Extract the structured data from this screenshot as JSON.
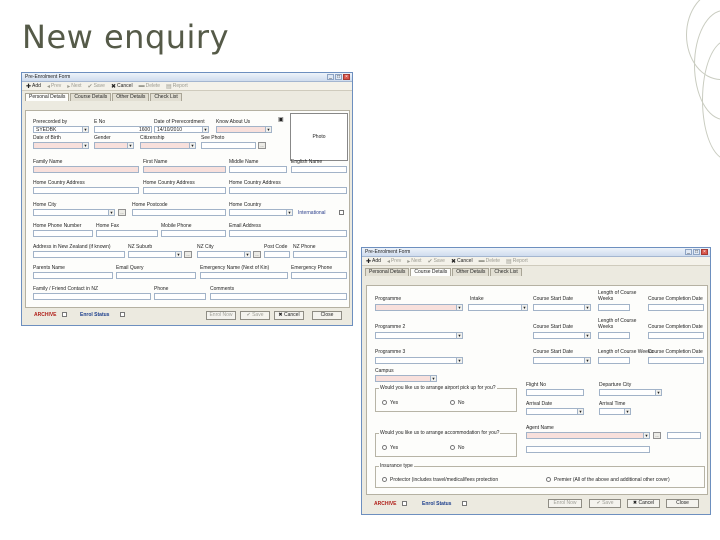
{
  "slide": {
    "title": "New enquiry"
  },
  "window1": {
    "title": "Pre-Enrolment Form",
    "toolbar": [
      {
        "glyph": "✚",
        "label": "Add",
        "enabled": true
      },
      {
        "glyph": "◂",
        "label": "Prev",
        "enabled": false
      },
      {
        "glyph": "▸",
        "label": "Next",
        "enabled": false
      },
      {
        "glyph": "✔",
        "label": "Save",
        "enabled": false
      },
      {
        "glyph": "✖",
        "label": "Cancel",
        "enabled": true
      },
      {
        "glyph": "▬",
        "label": "Delete",
        "enabled": false
      },
      {
        "glyph": "▤",
        "label": "Report",
        "enabled": false
      }
    ],
    "tabs": [
      "Personal Details",
      "Course Details",
      "Other Details",
      "Check List"
    ],
    "fields": {
      "prerecorded_by": {
        "label": "Prerecorded by",
        "value": "SYEDBK"
      },
      "e_no": {
        "label": "E No",
        "value": "1600"
      },
      "date_of_prerecordment": {
        "label": "Date of Prerecordment",
        "value": "14/10/2010"
      },
      "know_about_us": {
        "label": "Know About Us"
      },
      "date_of_birth": {
        "label": "Date of Birth"
      },
      "gender": {
        "label": "Gender"
      },
      "citizenship": {
        "label": "Citizenship"
      },
      "see_photo": {
        "label": "See Photo"
      },
      "photo": {
        "label": "Photo"
      },
      "family_name": {
        "label": "Family Name"
      },
      "first_name": {
        "label": "First Name"
      },
      "middle_name": {
        "label": "Middle Name"
      },
      "english_name": {
        "label": "English Name"
      },
      "home_country_address": {
        "label": "Home Country Address"
      },
      "home_country_address2": {
        "label": "Home Country Address"
      },
      "home_country_address3": {
        "label": "Home Country Address"
      },
      "home_city": {
        "label": "Home City"
      },
      "home_postcode": {
        "label": "Home Postcode"
      },
      "home_country": {
        "label": "Home Country"
      },
      "international": {
        "label": "International"
      },
      "home_phone_number": {
        "label": "Home Phone Number"
      },
      "home_fax": {
        "label": "Home Fax"
      },
      "mobile_phone": {
        "label": "Mobile Phone"
      },
      "email_address": {
        "label": "Email Address"
      },
      "address_nz": {
        "label": "Address in New Zealand (if known)"
      },
      "nz_suburb": {
        "label": "NZ Suburb"
      },
      "nz_city": {
        "label": "NZ City"
      },
      "post_code": {
        "label": "Post Code"
      },
      "nz_phone": {
        "label": "NZ Phone"
      },
      "parents_name": {
        "label": "Parents Name"
      },
      "email_query": {
        "label": "Email Query"
      },
      "emergency_name": {
        "label": "Emergency Name (Next of Kin)"
      },
      "emergency_phone": {
        "label": "Emergency Phone"
      },
      "family_contact": {
        "label": "Family / Friend Contact in NZ"
      },
      "phone": {
        "label": "Phone"
      },
      "comments": {
        "label": "Comments"
      }
    },
    "footer": {
      "archive": "ARCHIVE",
      "enrol_status": "Enrol Status",
      "buttons": [
        {
          "label": "Enrol Now",
          "enabled": false
        },
        {
          "label": "✔ Save",
          "enabled": false
        },
        {
          "label": "✖ Cancel",
          "enabled": true
        },
        {
          "label": "Close",
          "enabled": true
        }
      ]
    }
  },
  "window2": {
    "title": "Pre-Enrolment Form",
    "toolbar": [
      {
        "glyph": "✚",
        "label": "Add",
        "enabled": true
      },
      {
        "glyph": "◂",
        "label": "Prev",
        "enabled": false
      },
      {
        "glyph": "▸",
        "label": "Next",
        "enabled": false
      },
      {
        "glyph": "✔",
        "label": "Save",
        "enabled": false
      },
      {
        "glyph": "✖",
        "label": "Cancel",
        "enabled": true
      },
      {
        "glyph": "▬",
        "label": "Delete",
        "enabled": false
      },
      {
        "glyph": "▤",
        "label": "Report",
        "enabled": false
      }
    ],
    "tabs": [
      "Personal Details",
      "Course Details",
      "Other Details",
      "Check List"
    ],
    "fields": {
      "programme": {
        "label": "Programme"
      },
      "intake": {
        "label": "Intake"
      },
      "course_start_date": {
        "label": "Course Start Date"
      },
      "length_of_course_weeks": {
        "label": "Length of Course Weeks"
      },
      "course_completion_date": {
        "label": "Course Completion Date"
      },
      "programme2": {
        "label": "Programme 2"
      },
      "course_start_date2": {
        "label": "Course Start Date"
      },
      "length_of_course_weeks2": {
        "label": "Length of Course Weeks"
      },
      "course_completion_date2": {
        "label": "Course Completion Date"
      },
      "programme3": {
        "label": "Programme 3"
      },
      "course_start_date3": {
        "label": "Course Start Date"
      },
      "length_of_course_weeks3": {
        "label": "Length of Course Weeks"
      },
      "course_completion_date3": {
        "label": "Course Completion Date"
      },
      "campus": {
        "label": "Campus"
      },
      "airport_group": {
        "label": "Would you like us to arrange airport pick up for you?"
      },
      "yes": {
        "label": "Yes"
      },
      "no": {
        "label": "No"
      },
      "flight_no": {
        "label": "Flight No"
      },
      "departure_city": {
        "label": "Departure City"
      },
      "arrival_date": {
        "label": "Arrival Date"
      },
      "arrival_time": {
        "label": "Arrival Time"
      },
      "accommodation_group": {
        "label": "Would you like us to arrange accommodation for you?"
      },
      "agent_name": {
        "label": "Agent Name"
      },
      "insurance_group": {
        "label": "Insurance type"
      },
      "insurance_protector": {
        "label": "Protector (includes travel/medical/fees protection"
      },
      "insurance_premier": {
        "label": "Premier (All of the above and additional other cover)"
      }
    },
    "footer": {
      "archive": "ARCHIVE",
      "enrol_status": "Enrol Status",
      "buttons": [
        {
          "label": "Enrol Now",
          "enabled": false
        },
        {
          "label": "✔ Save",
          "enabled": false
        },
        {
          "label": "✖ Cancel",
          "enabled": true
        },
        {
          "label": "Close",
          "enabled": true
        }
      ]
    }
  }
}
